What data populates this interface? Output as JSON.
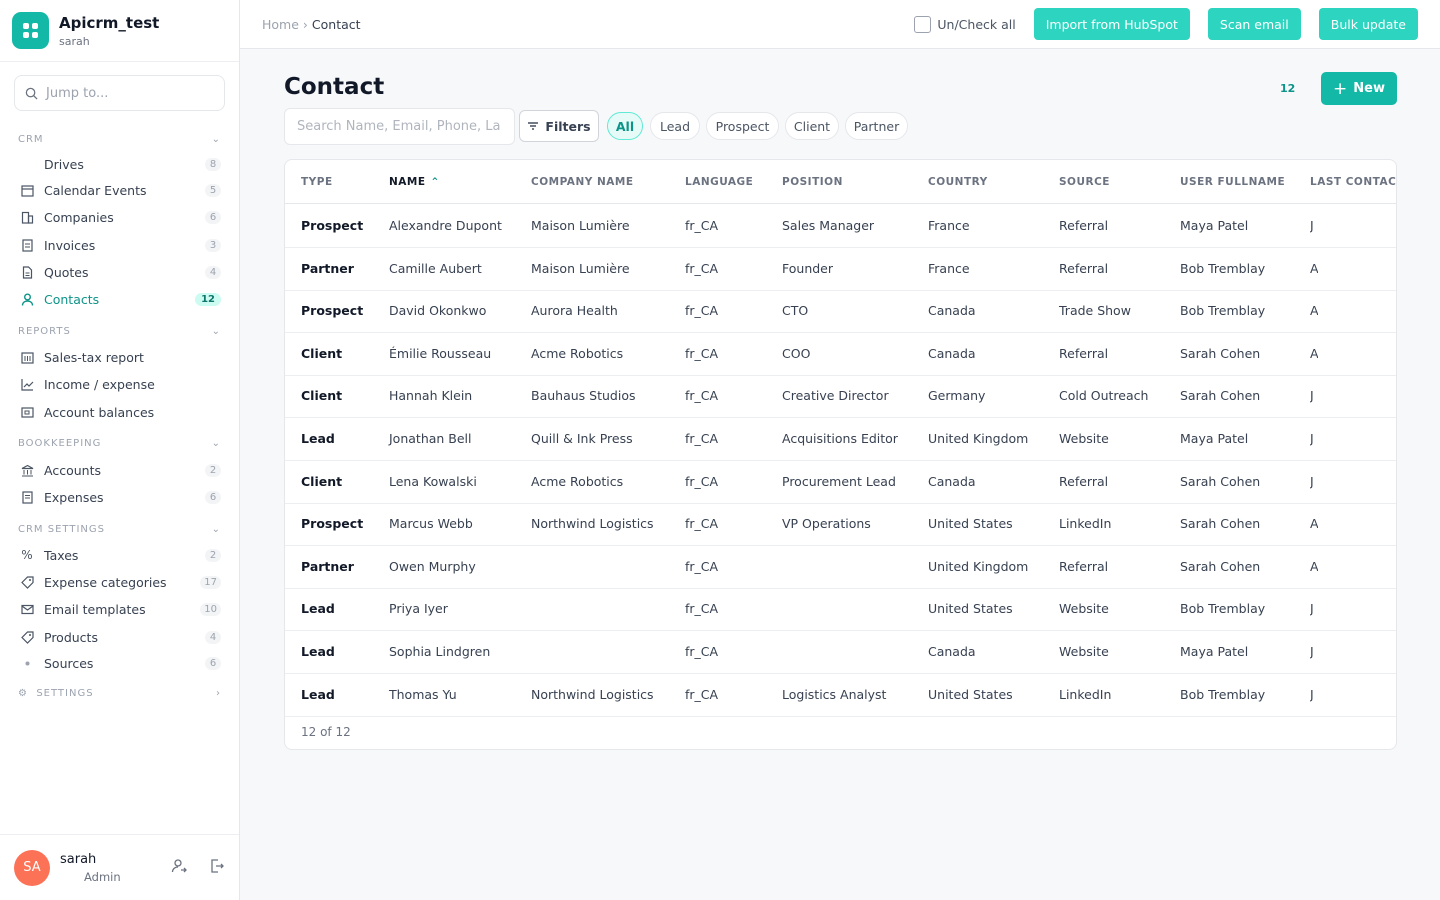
{
  "brand": {
    "title": "Apicrm_test",
    "subtitle": "sarah"
  },
  "jump": {
    "placeholder": "Jump to..."
  },
  "sections": {
    "crm": "CRM",
    "reports": "REPORTS",
    "bookkeeping": "BOOKKEEPING",
    "crm_settings": "CRM SETTINGS",
    "settings": "SETTINGS"
  },
  "nav": {
    "drives": {
      "label": "Drives",
      "count": "8"
    },
    "calendar": {
      "label": "Calendar Events",
      "count": "5"
    },
    "companies": {
      "label": "Companies",
      "count": "6"
    },
    "invoices": {
      "label": "Invoices",
      "count": "3"
    },
    "quotes": {
      "label": "Quotes",
      "count": "4"
    },
    "contacts": {
      "label": "Contacts",
      "count": "12"
    },
    "sales_tax": {
      "label": "Sales-tax report"
    },
    "income": {
      "label": "Income / expense"
    },
    "balances": {
      "label": "Account balances"
    },
    "accounts": {
      "label": "Accounts",
      "count": "2"
    },
    "expenses": {
      "label": "Expenses",
      "count": "6"
    },
    "taxes": {
      "label": "Taxes",
      "count": "2"
    },
    "expense_categories": {
      "label": "Expense categories",
      "count": "17"
    },
    "email_templates": {
      "label": "Email templates",
      "count": "10"
    },
    "products": {
      "label": "Products",
      "count": "4"
    },
    "sources": {
      "label": "Sources",
      "count": "6"
    }
  },
  "user": {
    "initials": "SA",
    "name": "sarah",
    "role": "Admin"
  },
  "breadcrumb": {
    "home": "Home",
    "sep": "›",
    "current": "Contact"
  },
  "topbar": {
    "check_label": "Un/Check all",
    "import_label": "Import from HubSpot",
    "scan_label": "Scan email",
    "bulk_label": "Bulk update"
  },
  "page": {
    "title": "Contact",
    "count": "12",
    "new_label": "New",
    "search_placeholder": "Search Name, Email, Phone, La",
    "filters_label": "Filters"
  },
  "chips": [
    "All",
    "Lead",
    "Prospect",
    "Client",
    "Partner"
  ],
  "table": {
    "columns": [
      "TYPE",
      "NAME",
      "COMPANY NAME",
      "LANGUAGE",
      "POSITION",
      "COUNTRY",
      "SOURCE",
      "USER FULLNAME",
      "LAST CONTACT"
    ],
    "rows": [
      [
        "Prospect",
        "Alexandre Dupont",
        "Maison Lumière",
        "fr_CA",
        "Sales Manager",
        "France",
        "Referral",
        "Maya Patel",
        "J"
      ],
      [
        "Partner",
        "Camille Aubert",
        "Maison Lumière",
        "fr_CA",
        "Founder",
        "France",
        "Referral",
        "Bob Tremblay",
        "A"
      ],
      [
        "Prospect",
        "David Okonkwo",
        "Aurora Health",
        "fr_CA",
        "CTO",
        "Canada",
        "Trade Show",
        "Bob Tremblay",
        "A"
      ],
      [
        "Client",
        "Émilie Rousseau",
        "Acme Robotics",
        "fr_CA",
        "COO",
        "Canada",
        "Referral",
        "Sarah Cohen",
        "A"
      ],
      [
        "Client",
        "Hannah Klein",
        "Bauhaus Studios",
        "fr_CA",
        "Creative Director",
        "Germany",
        "Cold Outreach",
        "Sarah Cohen",
        "J"
      ],
      [
        "Lead",
        "Jonathan Bell",
        "Quill & Ink Press",
        "fr_CA",
        "Acquisitions Editor",
        "United Kingdom",
        "Website",
        "Maya Patel",
        "J"
      ],
      [
        "Client",
        "Lena Kowalski",
        "Acme Robotics",
        "fr_CA",
        "Procurement Lead",
        "Canada",
        "Referral",
        "Sarah Cohen",
        "J"
      ],
      [
        "Prospect",
        "Marcus Webb",
        "Northwind Logistics",
        "fr_CA",
        "VP Operations",
        "United States",
        "LinkedIn",
        "Sarah Cohen",
        "A"
      ],
      [
        "Partner",
        "Owen Murphy",
        "",
        "fr_CA",
        "",
        "United Kingdom",
        "Referral",
        "Sarah Cohen",
        "A"
      ],
      [
        "Lead",
        "Priya Iyer",
        "",
        "fr_CA",
        "",
        "United States",
        "Website",
        "Bob Tremblay",
        "J"
      ],
      [
        "Lead",
        "Sophia Lindgren",
        "",
        "fr_CA",
        "",
        "Canada",
        "Website",
        "Maya Patel",
        "J"
      ],
      [
        "Lead",
        "Thomas Yu",
        "Northwind Logistics",
        "fr_CA",
        "Logistics Analyst",
        "United States",
        "LinkedIn",
        "Bob Tremblay",
        "J"
      ]
    ],
    "footer": "12 of 12"
  },
  "colors": {
    "accent": "#14b8a6",
    "button": "#2dd4bf",
    "avatar": "#fb7256"
  }
}
